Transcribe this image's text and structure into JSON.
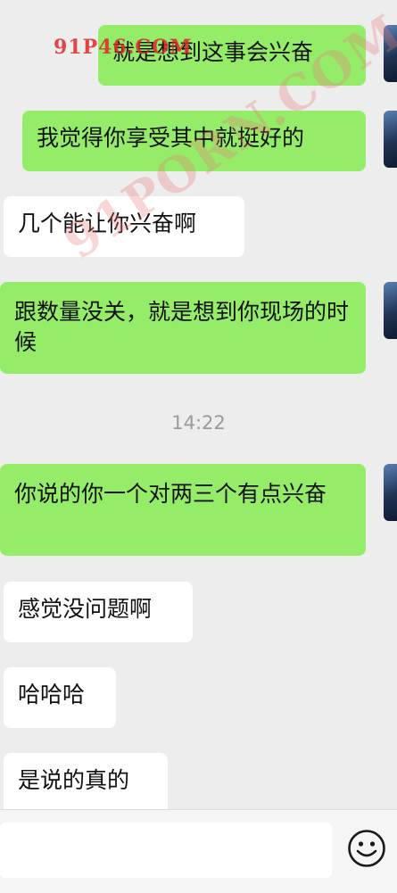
{
  "messages": [
    {
      "side": "out",
      "text": "就是想到这事会兴奋"
    },
    {
      "side": "out",
      "text": "我觉得你享受其中就挺好的"
    },
    {
      "side": "in",
      "text": "几个能让你兴奋啊"
    },
    {
      "side": "out",
      "text": "跟数量没关，就是想到你现场的时候"
    },
    {
      "side": "out",
      "text": "你说的你一个对两三个有点兴奋"
    },
    {
      "side": "in",
      "text": "感觉没问题啊"
    },
    {
      "side": "in",
      "text": "哈哈哈"
    },
    {
      "side": "in",
      "text": "是说的真的"
    }
  ],
  "timestamp": "14:22",
  "watermark": {
    "top": "91P46.COM",
    "diagonal": "91PORN.COM"
  },
  "input": {
    "emoji_icon": "smiley-icon"
  },
  "colors": {
    "outgoing": "#95ec69",
    "incoming": "#ffffff",
    "background": "#ededed"
  }
}
